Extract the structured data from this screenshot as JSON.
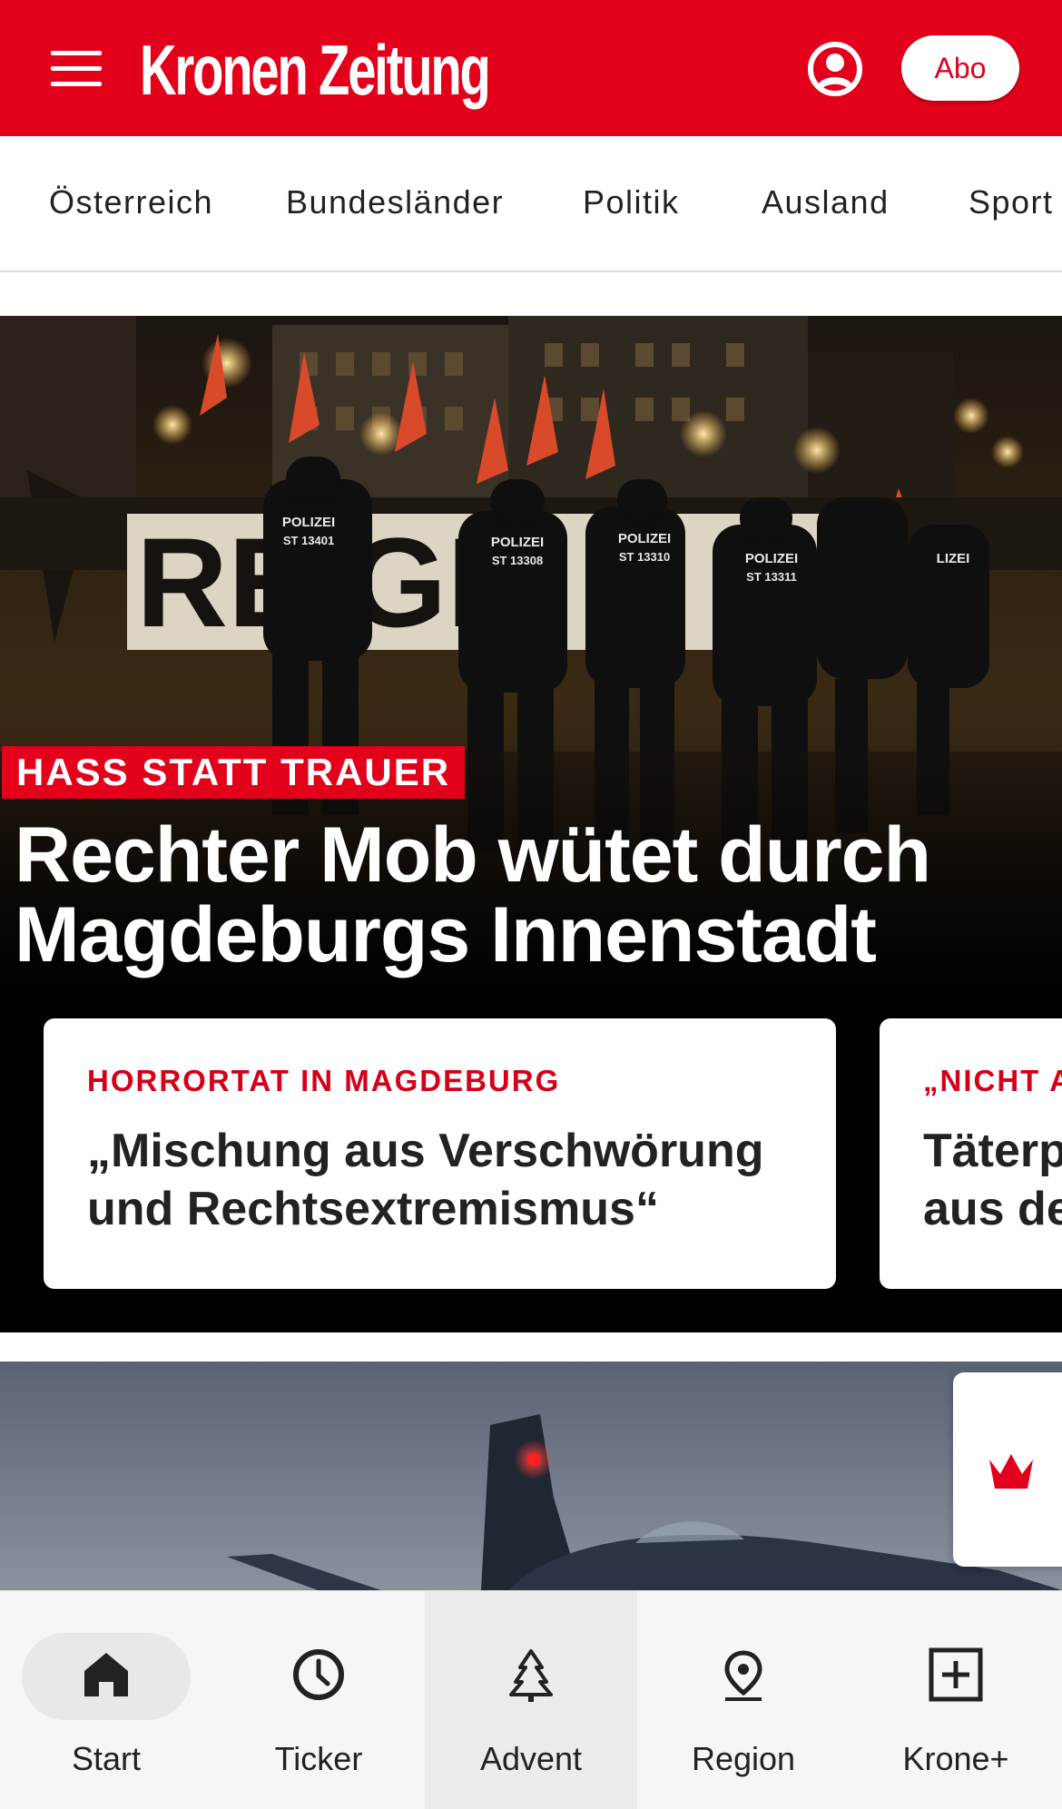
{
  "header": {
    "brand": "Kronen Zeitung",
    "abo_label": "Abo",
    "menu_icon": "hamburger-menu-icon",
    "user_icon": "user-account-icon"
  },
  "nav": {
    "categories": [
      "Österreich",
      "Bundesländer",
      "Politik",
      "Ausland",
      "Sport"
    ]
  },
  "hero": {
    "kicker": "HASS STATT TRAUER",
    "title_line1": "Rechter Mob wütet durch",
    "title_line2": "Magdeburgs Innenstadt",
    "photo_text": {
      "banner": "RE  GR",
      "police_1": "POLIZEI",
      "police_1_id": "ST 13401",
      "police_2": "POLIZEI",
      "police_2_id": "ST 13308",
      "police_3": "POLIZEI",
      "police_3_id": "ST 13310",
      "police_4": "POLIZEI",
      "police_4_id": "ST 13311",
      "police_5": "LIZEI"
    },
    "cards": [
      {
        "kicker": "HORRORTAT IN MAGDEBURG",
        "title_line1": "„Mischung aus Verschwörung",
        "title_line2": "und Rechtsextremismus“"
      },
      {
        "kicker": "„NICHT A",
        "title_line1": "Täterp",
        "title_line2": "aus de"
      }
    ]
  },
  "colors": {
    "brand_red": "#e2001a",
    "text_dark": "#222222"
  },
  "bottom_nav": [
    {
      "label": "Start",
      "icon": "home-icon",
      "active": true
    },
    {
      "label": "Ticker",
      "icon": "clock-icon",
      "active": false
    },
    {
      "label": "Advent",
      "icon": "tree-icon",
      "active": false
    },
    {
      "label": "Region",
      "icon": "map-pin-icon",
      "active": false
    },
    {
      "label": "Krone+",
      "icon": "plus-square-icon",
      "active": false
    }
  ]
}
